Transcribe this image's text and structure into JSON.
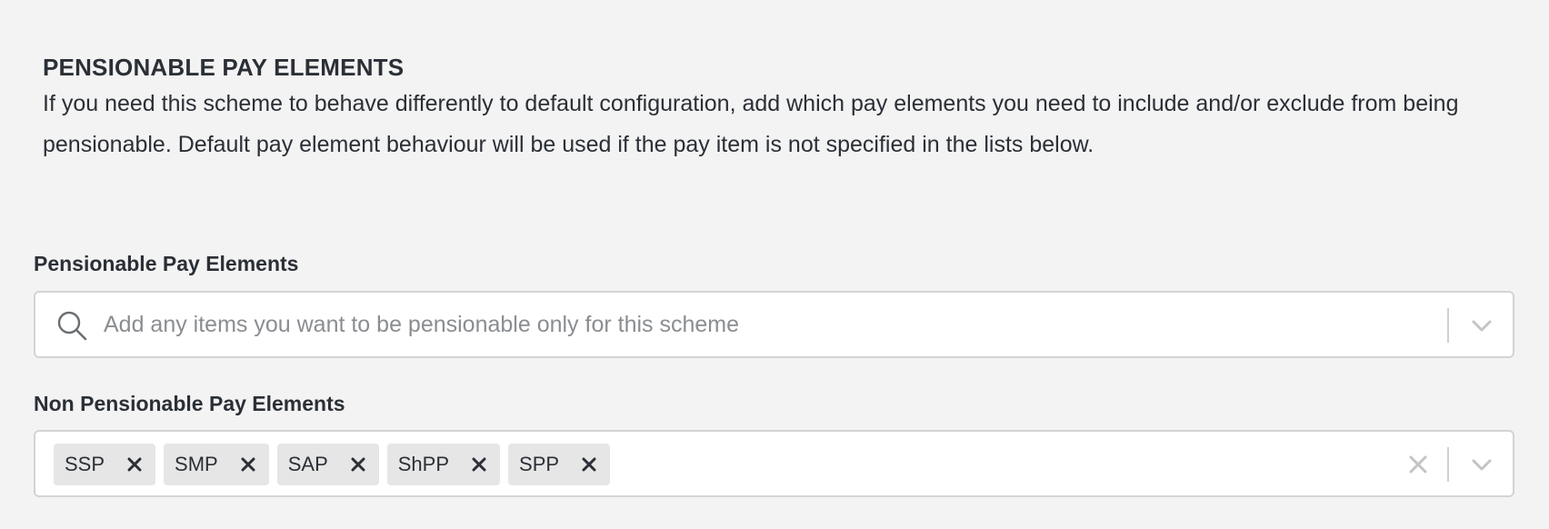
{
  "section": {
    "title": "PENSIONABLE PAY ELEMENTS",
    "description": "If you need this scheme to behave differently to default configuration, add which pay elements you need to include and/or exclude from being pensionable. Default pay element behaviour will be used if the pay item is not specified in the lists below."
  },
  "pensionable": {
    "label": "Pensionable Pay Elements",
    "placeholder": "Add any items you want to be pensionable only for this scheme",
    "icon": "search-icon"
  },
  "non_pensionable": {
    "label": "Non Pensionable Pay Elements",
    "chips": [
      "SSP",
      "SMP",
      "SAP",
      "ShPP",
      "SPP"
    ]
  },
  "colors": {
    "background": "#f3f3f3",
    "text": "#2b2f36",
    "placeholder": "#8a8d91",
    "chip_bg": "#e6e6e6",
    "border": "#d4d4d4"
  }
}
